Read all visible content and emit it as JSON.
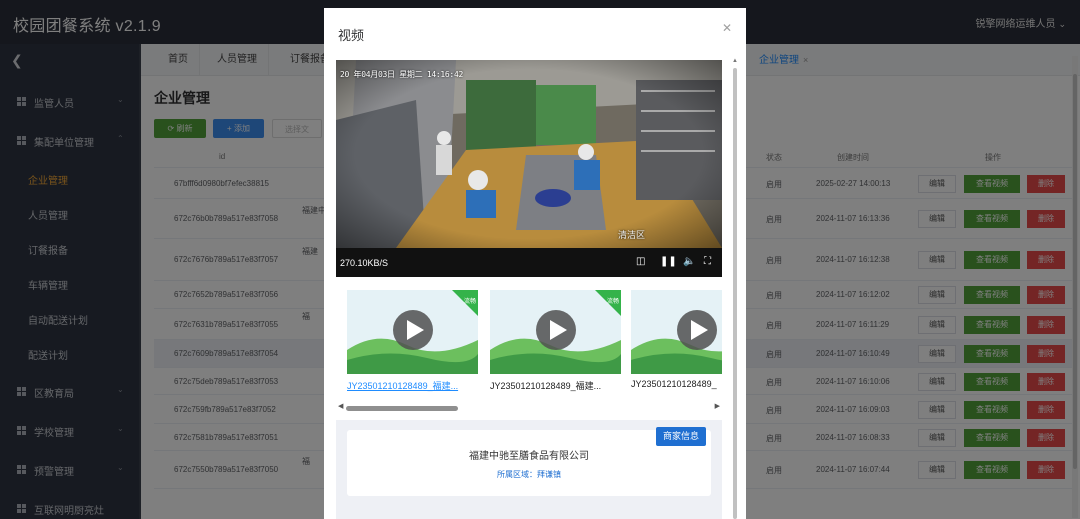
{
  "app": {
    "title": "校园团餐系统 v2.1.9",
    "user": "锐擎网络运维人员"
  },
  "sidebar": {
    "groups": [
      {
        "label": "监管人员"
      },
      {
        "label": "集配单位管理"
      }
    ],
    "sub_items": [
      {
        "label": "企业管理",
        "active": true
      },
      {
        "label": "人员管理"
      },
      {
        "label": "订餐报备"
      },
      {
        "label": "车辆管理"
      },
      {
        "label": "自动配送计划"
      },
      {
        "label": "配送计划"
      }
    ],
    "groups_after": [
      {
        "label": "区教育局"
      },
      {
        "label": "学校管理"
      },
      {
        "label": "预警管理"
      },
      {
        "label": "互联网明厨亮灶"
      }
    ]
  },
  "tabs": [
    {
      "label": "首页"
    },
    {
      "label": "人员管理"
    },
    {
      "label": "订餐报备"
    },
    {
      "label": "企业管理",
      "active": true
    }
  ],
  "page": {
    "title": "企业管理",
    "refresh_label": "刷新",
    "add_label": "添加",
    "import_label": "选择文"
  },
  "table": {
    "columns": {
      "id": "id",
      "status": "状态",
      "created": "创建时间",
      "actions": "操作"
    },
    "action_labels": {
      "edit": "编辑",
      "video": "查看视频",
      "delete": "删除"
    },
    "rows": [
      {
        "id": "67bfff6d0980bf7efec38815",
        "frag": "",
        "status": "启用",
        "created": "2025-02-27 14:00:13"
      },
      {
        "id": "672c76b0b789a517e83f7058",
        "frag": "福建中",
        "status": "启用",
        "created": "2024-11-07 16:13:36"
      },
      {
        "id": "672c7676b789a517e83f7057",
        "frag": "福建",
        "status": "启用",
        "created": "2024-11-07 16:12:38"
      },
      {
        "id": "672c7652b789a517e83f7056",
        "frag": "",
        "status": "启用",
        "created": "2024-11-07 16:12:02"
      },
      {
        "id": "672c7631b789a517e83f7055",
        "frag": "福",
        "status": "启用",
        "created": "2024-11-07 16:11:29"
      },
      {
        "id": "672c7609b789a517e83f7054",
        "frag": "",
        "status": "启用",
        "created": "2024-11-07 16:10:49"
      },
      {
        "id": "672c75deb789a517e83f7053",
        "frag": "",
        "status": "启用",
        "created": "2024-11-07 16:10:06"
      },
      {
        "id": "672c759fb789a517e83f7052",
        "frag": "",
        "status": "启用",
        "created": "2024-11-07 16:09:03"
      },
      {
        "id": "672c7581b789a517e83f7051",
        "frag": "",
        "status": "启用",
        "created": "2024-11-07 16:08:33"
      },
      {
        "id": "672c7550b789a517e83f7050",
        "frag": "福",
        "status": "启用",
        "created": "2024-11-07 16:07:44"
      }
    ]
  },
  "dialog": {
    "title": "视频",
    "close_icon": "close-icon",
    "player": {
      "osd_time": "20 年04月03日 星期二 14:16:42",
      "camera_label": "清洁区",
      "bitrate": "270.10KB/S"
    },
    "thumbnails": [
      {
        "caption": "JY23501210128489_福建...",
        "selected": true,
        "tag": "流畅"
      },
      {
        "caption": "JY23501210128489_福建...",
        "selected": false,
        "tag": "流畅"
      },
      {
        "caption": "JY23501210128489_",
        "selected": false,
        "tag": "流畅"
      }
    ],
    "merchant": {
      "badge": "商家信息",
      "name": "福建中驰至膳食品有限公司",
      "area": "所属区域：拜谦镇"
    }
  }
}
